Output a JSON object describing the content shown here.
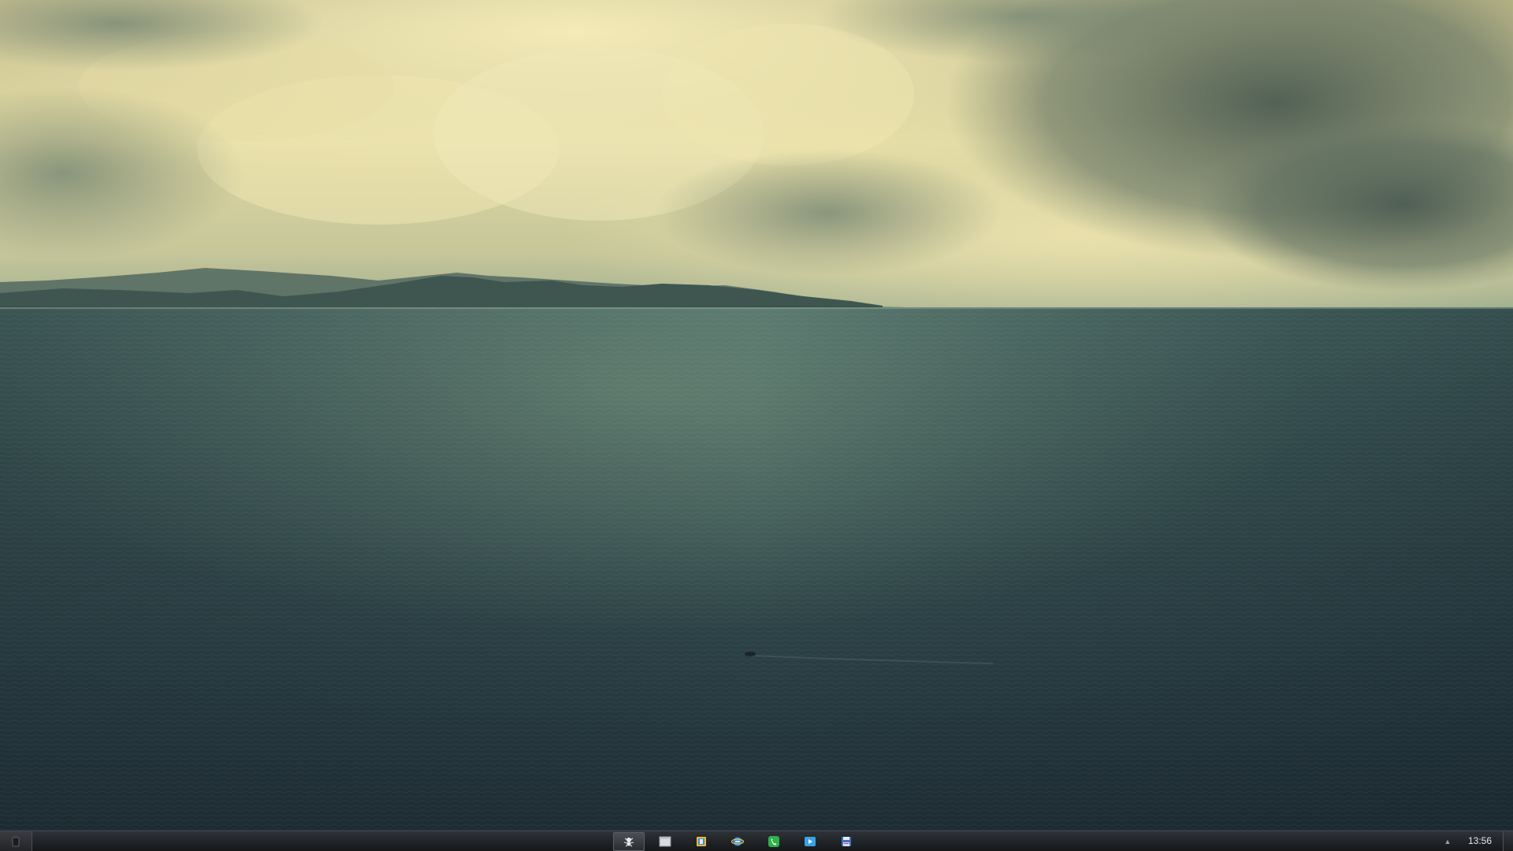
{
  "desktop": {
    "wallpaper": "ocean-under-stormy-clouds",
    "colors": {
      "sky_light": "#e9e3ad",
      "sky_dark": "#5f7262",
      "sea_top": "#3f5a5a",
      "sea_bottom": "#1d2c33",
      "taskbar": "#1f2124"
    }
  },
  "taskbar": {
    "start_icon": "start-orb-icon",
    "items": [
      {
        "icon": "spider-app-icon",
        "active": true
      },
      {
        "icon": "blank-window-icon",
        "active": false
      },
      {
        "icon": "file-explorer-icon",
        "active": false
      },
      {
        "icon": "internet-explorer-icon",
        "active": false
      },
      {
        "icon": "phone-app-icon",
        "active": false
      },
      {
        "icon": "media-player-icon",
        "active": false
      },
      {
        "icon": "save-disk-icon",
        "active": false
      }
    ],
    "tray": {
      "arrow_icon": "tray-up-arrow-icon",
      "clock": "13:56"
    }
  }
}
